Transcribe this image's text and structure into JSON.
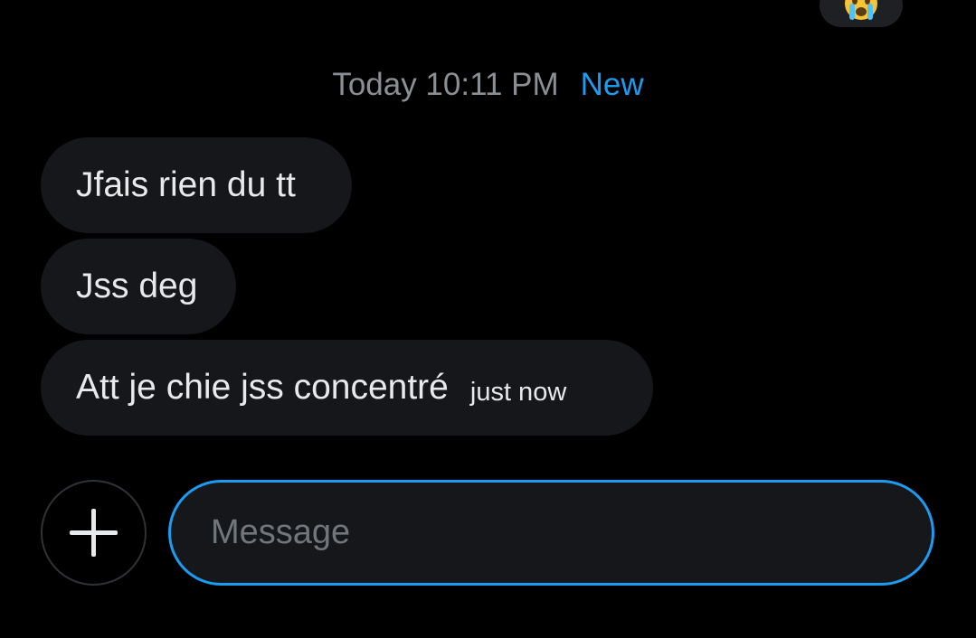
{
  "reaction": {
    "emoji_name": "loudly-crying-face-emoji",
    "colors": {
      "face": "#f7c338",
      "tears": "#4fc3f7"
    }
  },
  "date_separator": {
    "date_text": "Today 10:11 PM",
    "new_label": "New"
  },
  "messages": [
    {
      "text": "Jfais rien du tt"
    },
    {
      "text": "Jss deg"
    },
    {
      "text": "Att je chie jss concentré",
      "timestamp": "just now"
    }
  ],
  "composer": {
    "add_icon": "plus-icon",
    "placeholder": "Message",
    "value": ""
  },
  "colors": {
    "background": "#000000",
    "bubble": "#16171a",
    "accent": "#1d9bf0",
    "muted_text": "#8b8f94",
    "text": "#e7e9ea"
  }
}
